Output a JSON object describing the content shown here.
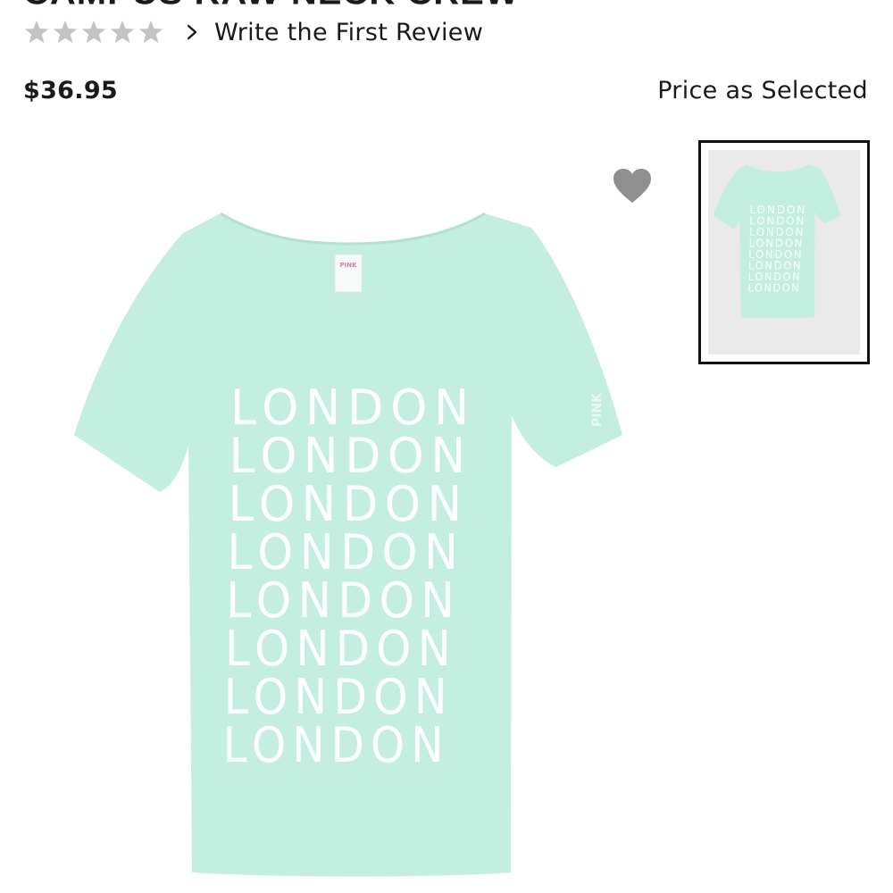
{
  "product": {
    "title": "CAMPUS RAW NECK CREW",
    "rating_stars": 5,
    "rating_filled": 0,
    "review_link": "Write the First Review",
    "price": "$36.95",
    "price_note": "Price as Selected"
  },
  "gallery": {
    "print_text": "LONDON",
    "print_repeat": 8,
    "tag_text": "PINK",
    "sleeve_text": "PINK",
    "shirt_color": "#c3eee0",
    "print_color": "#ffffff",
    "favorite_icon": "heart-icon",
    "thumbnail_selected": true
  },
  "colors": {
    "star_empty": "#c4c4c4",
    "heart": "#8f8f8f",
    "thumb_border": "#111111",
    "thumb_bg": "#eaeaea"
  }
}
